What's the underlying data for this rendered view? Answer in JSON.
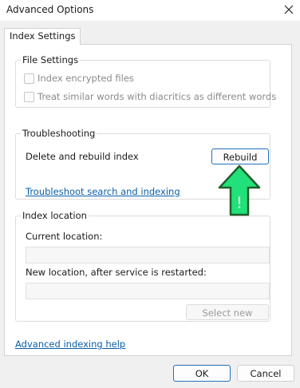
{
  "window": {
    "title": "Advanced Options",
    "close_icon": "close-icon"
  },
  "tabs": [
    {
      "label": "Index Settings",
      "active": true
    }
  ],
  "file_settings": {
    "legend": "File Settings",
    "options": [
      {
        "label": "Index encrypted files",
        "checked": false,
        "enabled": false
      },
      {
        "label": "Treat similar words with diacritics as different words",
        "checked": false,
        "enabled": false
      }
    ]
  },
  "troubleshooting": {
    "legend": "Troubleshooting",
    "rebuild_label": "Delete and rebuild index",
    "rebuild_button": "Rebuild",
    "troubleshoot_link": "Troubleshoot search and indexing"
  },
  "index_location": {
    "legend": "Index location",
    "current_label": "Current location:",
    "current_value": "",
    "new_label": "New location, after service is restarted:",
    "new_value": "",
    "select_new_button": "Select new"
  },
  "advanced_help_link": "Advanced indexing help",
  "footer": {
    "ok_label": "OK",
    "cancel_label": "Cancel"
  },
  "annotation": {
    "icon": "arrow-up-icon",
    "color": "#22e07a",
    "stroke": "#1f5f2a"
  }
}
